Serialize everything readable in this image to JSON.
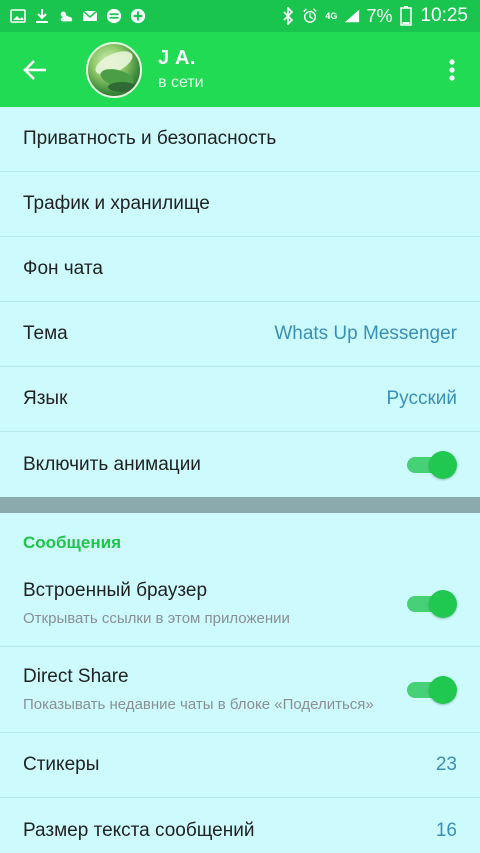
{
  "status_bar": {
    "battery": "7%",
    "time": "10:25",
    "network": "4G",
    "left_icons": [
      "image-icon",
      "download-icon",
      "weather-icon",
      "mail-icon",
      "app-icon",
      "plus-icon"
    ]
  },
  "header": {
    "name": "J A.",
    "status": "в сети"
  },
  "settings": {
    "privacy": {
      "label": "Приватность и безопасность"
    },
    "traffic": {
      "label": "Трафик и хранилище"
    },
    "chat_background": {
      "label": "Фон чата"
    },
    "theme": {
      "label": "Тема",
      "value": "Whats Up Messenger"
    },
    "language": {
      "label": "Язык",
      "value": "Русский"
    },
    "animations": {
      "label": "Включить анимации",
      "enabled": true
    }
  },
  "messages_section": {
    "header": "Сообщения",
    "in_app_browser": {
      "label": "Встроенный браузер",
      "sub": "Открывать ссылки в этом приложении",
      "enabled": true
    },
    "direct_share": {
      "label": "Direct Share",
      "sub": "Показывать недавние чаты в блоке «Поделиться»",
      "enabled": true
    },
    "stickers": {
      "label": "Стикеры",
      "value": "23"
    },
    "text_size": {
      "label": "Размер текста сообщений",
      "value": "16"
    }
  },
  "colors": {
    "status_bar": "#19C54F",
    "app_bar": "#21DB55",
    "background": "#CDFBFD",
    "accent_value": "#3A8FB8",
    "section_header": "#1FC44A",
    "toggle_on": "#20C850"
  }
}
